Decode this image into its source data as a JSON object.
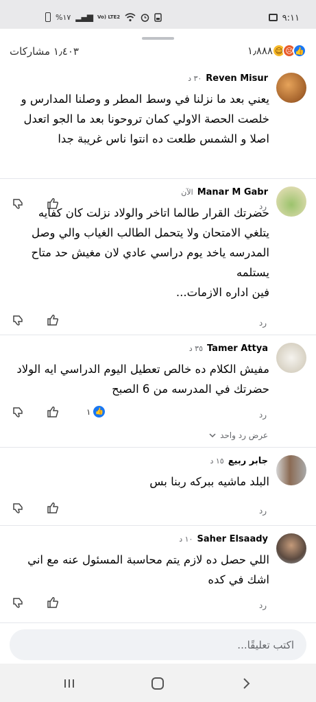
{
  "status_bar": {
    "time": "٩:١١",
    "battery_percent": "%١٧",
    "network_label": "Vo) LTE2"
  },
  "header": {
    "reaction_count": "١٫٨٨٨",
    "shares": "١٫٤٠٣ مشاركات",
    "reaction_icons": [
      "haha-emoji-icon",
      "angry-emoji-icon",
      "like-emoji-icon"
    ]
  },
  "comments": [
    {
      "name": "Reven Misur",
      "time": "٣٠ د",
      "text": "يعني بعد ما نزلنا في وسط المطر و وصلنا المدارس و خلصت الحصة الاولي كمان تروحونا بعد ما الجو اتعدل اصلا و الشمس طلعت ده انتوا ناس غريبة جدا",
      "reply": "رد"
    },
    {
      "name": "Manar M Gabr",
      "time": "الآن",
      "text": "حضرتك القرار طالما اتاخر والولاد نزلت كان كفايه يتلغي الامتحان ولا يتحمل الطالب الغياب والي وصل المدرسه ياخد يوم دراسي عادي لان مغيش حد متاح يستلمه\nفين اداره الازمات...",
      "reply": "رد"
    },
    {
      "name": "Tamer Attya",
      "time": "٣٥ د",
      "text": "مفيش الكلام ده خالص تعطيل اليوم الدراسي ايه الولاد حضرتك في المدرسه من 6 الصبح",
      "reply": "رد",
      "like_count": "١",
      "view_replies": "عرض رد واحد"
    },
    {
      "name": "جابر ربيع",
      "time": "١٥ د",
      "text": "البلد ماشيه ببركه ربنا بس",
      "reply": "رد"
    },
    {
      "name": "Saher Elsaady",
      "time": "١٠ د",
      "text": "اللي حصل ده لازم يتم محاسبة المسئول عنه مع اني اشك في كده",
      "reply": "رد"
    }
  ],
  "composer": {
    "placeholder": "اكتب تعليقًا..."
  },
  "colors": {
    "accent": "#1877f2",
    "secondary_text": "#65676b",
    "status_bar_bg": "#e9e9eb"
  }
}
